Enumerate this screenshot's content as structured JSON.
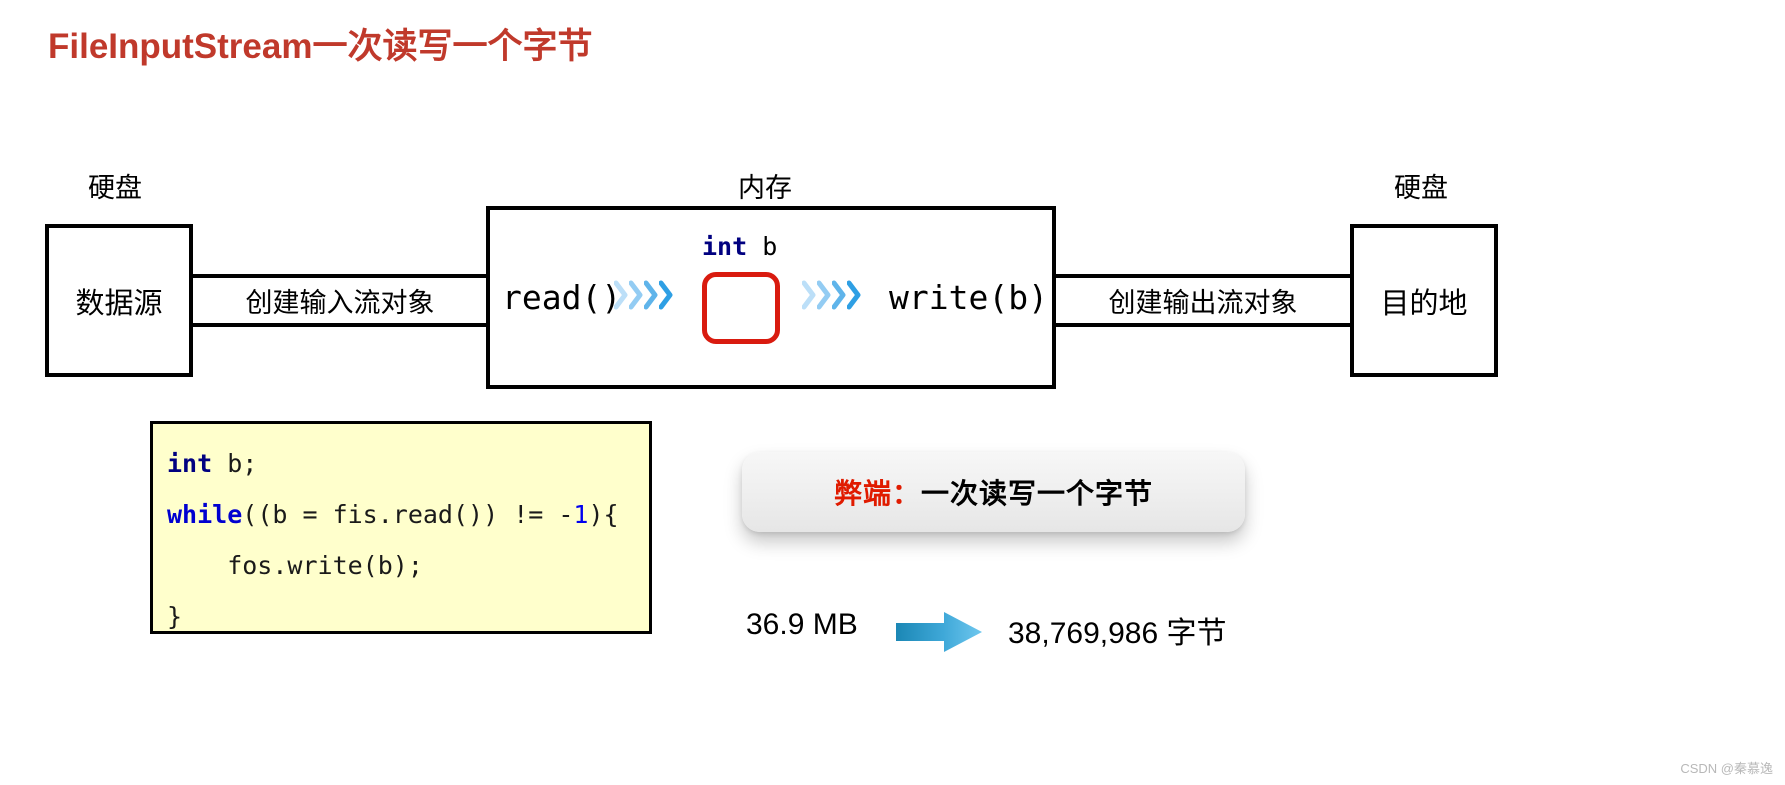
{
  "title": "FileInputStream一次读写一个字节",
  "diagram": {
    "left_caption": "硬盘",
    "middle_caption": "内存",
    "right_caption": "硬盘",
    "source_box": "数据源",
    "dest_box": "目的地",
    "rail_input": "创建输入流对象",
    "rail_output": "创建输出流对象",
    "variable_type": "int",
    "variable_name": "b",
    "read_call": "read()",
    "write_call": "write(b)"
  },
  "code": {
    "line1_kw": "int",
    "line1_rest": " b;",
    "line2_kw": "while",
    "line2_mid": "((b = fis.read()) != -",
    "line2_num": "1",
    "line2_end": "){",
    "line3": "    fos.write(b);",
    "line4": "}"
  },
  "callout": {
    "label": "弊端：",
    "text": "一次读写一个字节"
  },
  "size": {
    "left": "36.9 MB",
    "right": "38,769,986 字节"
  },
  "watermark": "CSDN @秦慕逸",
  "colors": {
    "title": "#c0392b",
    "keyword_navy": "#000080",
    "keyword_blue": "#0000d0",
    "slot_border": "#d91b0f",
    "callout_red": "#e01b00",
    "code_bg": "#ffffcc",
    "arrow_dark": "#1b87b5",
    "arrow_light": "#6fc7ee"
  }
}
